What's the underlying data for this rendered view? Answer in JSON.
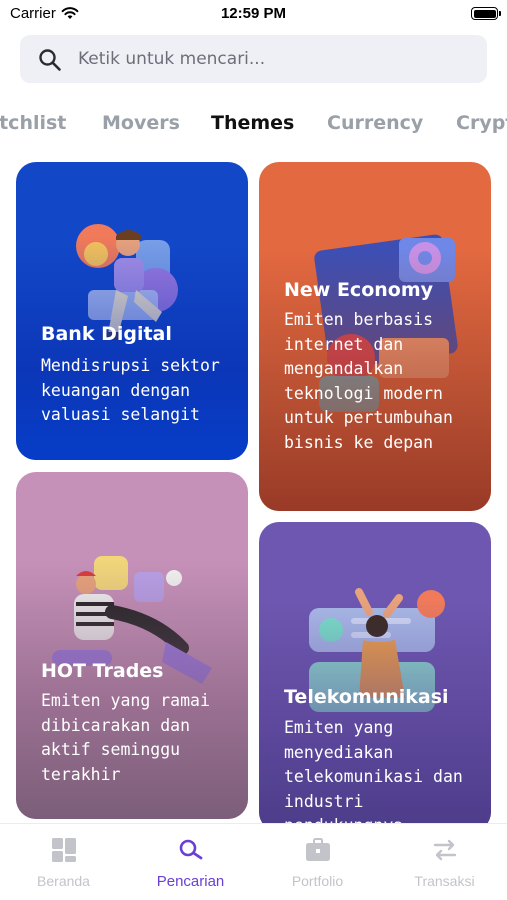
{
  "status_bar": {
    "carrier": "Carrier",
    "time": "12:59 PM"
  },
  "search": {
    "placeholder": "Ketik untuk mencari...",
    "value": ""
  },
  "tabs": [
    {
      "label": "Watchlist",
      "active": false
    },
    {
      "label": "Movers",
      "active": false
    },
    {
      "label": "Themes",
      "active": true
    },
    {
      "label": "Currency",
      "active": false
    },
    {
      "label": "Crypto",
      "active": false
    }
  ],
  "themes": [
    {
      "title": "Bank Digital",
      "description": "Mendisrupsi sektor keuangan dengan valuasi selangit",
      "color": "#1248c8"
    },
    {
      "title": "New Economy",
      "description": "Emiten berbasis internet dan mengandalkan teknologi modern untuk pertumbuhan bisnis ke depan",
      "color": "#e36940"
    },
    {
      "title": "HOT Trades",
      "description": "Emiten yang ramai dibicarakan dan aktif seminggu terakhir",
      "color": "#c691b9"
    },
    {
      "title": "Telekomunikasi",
      "description": "Emiten yang menyediakan telekomunikasi dan industri pendukungnya",
      "color": "#6d57b0"
    }
  ],
  "bottom_nav": [
    {
      "label": "Beranda",
      "icon": "grid-icon",
      "active": false
    },
    {
      "label": "Pencarian",
      "icon": "search-icon",
      "active": true
    },
    {
      "label": "Portfolio",
      "icon": "briefcase-icon",
      "active": false
    },
    {
      "label": "Transaksi",
      "icon": "transfer-arrows-icon",
      "active": false
    }
  ],
  "colors": {
    "accent": "#6a3fd6",
    "inactive_tab": "#9aa0a8",
    "search_bg": "#eef0f6"
  }
}
